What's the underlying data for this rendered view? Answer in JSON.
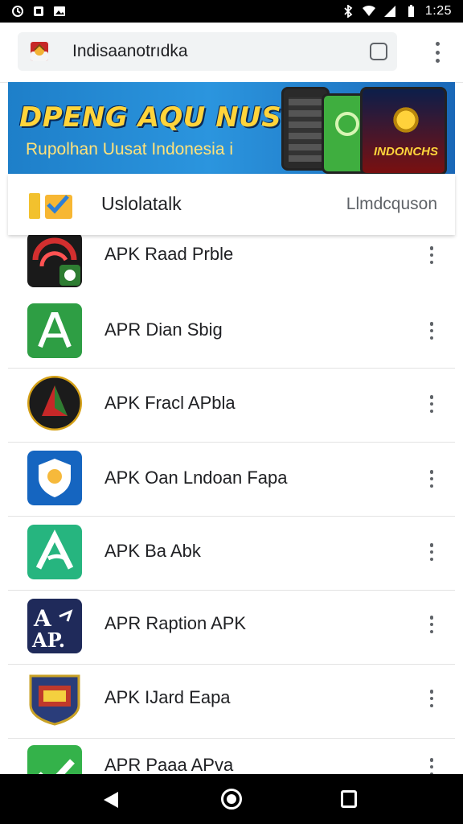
{
  "status_bar": {
    "time": "1:25",
    "left_icons": [
      "sync-icon",
      "photo-icon",
      "image-icon"
    ],
    "right_icons": [
      "bluetooth-icon",
      "wifi-icon",
      "signal-icon",
      "battery-icon"
    ]
  },
  "browser": {
    "url": "Indisaanotrıdka",
    "favicon": "garuda-icon"
  },
  "banner": {
    "title": "DPENG AQU NUSIA",
    "subtitle": "Rupolhan Uusat Indonesia i",
    "phone_label": "INDONCHS"
  },
  "header": {
    "title": "Uslolatalk",
    "link": "Llmdcquson"
  },
  "apps": [
    {
      "name": "APK Raad Prble",
      "icon": "red-swirl-icon"
    },
    {
      "name": "APR Dian Sbig",
      "icon": "green-a-icon"
    },
    {
      "name": "APK Fracl APbla",
      "icon": "red-arrow-icon"
    },
    {
      "name": "APK Oan Lndoan Fapa",
      "icon": "blue-shield-icon"
    },
    {
      "name": "APK Ba Abk",
      "icon": "teal-a-icon"
    },
    {
      "name": "APR Raption APK",
      "icon": "navy-ap-icon"
    },
    {
      "name": "APK IJard Eapa",
      "icon": "badge-emblem-icon"
    },
    {
      "name": "APR Paaa APva",
      "icon": "green-check-icon"
    }
  ],
  "colors": {
    "banner_blue": "#2b95de",
    "banner_yellow": "#ffd43b",
    "text": "#202124",
    "muted": "#5f6368"
  }
}
